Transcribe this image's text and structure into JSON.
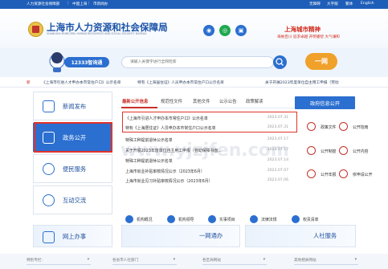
{
  "topbar": {
    "left_links": [
      "人力资源社会保障部",
      "中国上海",
      "市新闻办"
    ],
    "right_links": [
      "无障碍",
      "大字版",
      "繁体",
      "English"
    ]
  },
  "header": {
    "title": "上海市人力资源和社会保障局",
    "subtitle": "SHANGHAI MUNICIPAL HUMAN RESOURCES AND SOCIAL SECURITY BUREAU",
    "spirit_title": "上海城市精神",
    "spirit_sub": "海纳百川  追求卓越  开明睿智  大气谦和"
  },
  "search": {
    "hotline_label": "12333智询通",
    "placeholder": "请输入关键字进行全网检索",
    "onewin_label": "一网"
  },
  "marquee": {
    "items": [
      "新",
      "《上海市引进人才申办本市常住户口》公示名单",
      "特有《上海居住证》人员申办本市常住户口公示名单",
      "关于开展2023年度单位自主用工申报（劳动"
    ]
  },
  "left_nav": {
    "items": [
      {
        "label": "新闻发布"
      },
      {
        "label": "政务公开"
      },
      {
        "label": "便民服务"
      },
      {
        "label": "互动交流"
      },
      {
        "label": "网上办事"
      }
    ]
  },
  "tabs": {
    "items": [
      "最新公开信息",
      "规范性文件",
      "其他文件",
      "公示公告",
      "政策解读"
    ],
    "active_index": 0,
    "gov_open_button": "政府信息公开"
  },
  "news": [
    {
      "title": "《上海市引进人才申办本市常住户口》公示名单",
      "date": "2023.07.31"
    },
    {
      "title": "特有《上海居住证》人员申办本市常住户口公示名单",
      "date": "2023.07.31"
    },
    {
      "title": "特殊工种提前退休公示名单",
      "date": "2023.07.17"
    },
    {
      "title": "关于开展2023年度单位自主用工申报（劳动保障书面...",
      "date": "2023.07.17"
    },
    {
      "title": "特殊工种提前退休公示名单",
      "date": "2023.07.14"
    },
    {
      "title": "上海市就业补贴审核情况公示（2023年6月）",
      "date": "2023.07.07"
    },
    {
      "title": "上海市就业见习补贴审核情况公示（2023年6月）",
      "date": "2023.07.06"
    }
  ],
  "quick_links": [
    {
      "label": "政策文件"
    },
    {
      "label": "公开指南"
    },
    {
      "label": "公开制度"
    },
    {
      "label": "公开内容"
    },
    {
      "label": "公开年报"
    },
    {
      "label": "依申请公开"
    }
  ],
  "icon_row": [
    {
      "label": "机构概况"
    },
    {
      "label": "机构领导"
    },
    {
      "label": "实事项目"
    },
    {
      "label": "法律法规"
    },
    {
      "label": "权责清单"
    }
  ],
  "banners": {
    "online_service": "网上办事",
    "one_network": "一网通办",
    "social_portal": "人社服务"
  },
  "footer": {
    "selects": [
      "特别专栏:",
      "各省市人社部门",
      "各区局网站",
      "其他相关网站"
    ],
    "watermark": "www.yjzjfen.com"
  }
}
